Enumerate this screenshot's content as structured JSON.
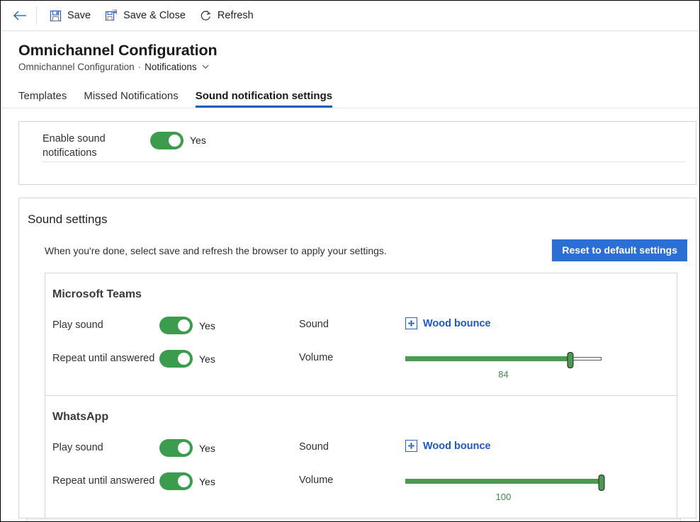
{
  "commandbar": {
    "back_label": "back-arrow",
    "buttons": [
      {
        "icon": "save-icon",
        "label": "Save"
      },
      {
        "icon": "save-and-close-icon",
        "label": "Save & Close"
      },
      {
        "icon": "refresh-icon",
        "label": "Refresh"
      }
    ]
  },
  "header": {
    "title": "Omnichannel Configuration",
    "breadcrumb": {
      "root": "Omnichannel Configuration",
      "separator": "·",
      "current": "Notifications",
      "chevron": "chevron-down-icon"
    }
  },
  "tabs": [
    {
      "label": "Templates",
      "active": false
    },
    {
      "label": "Missed Notifications",
      "active": false
    },
    {
      "label": "Sound notification settings",
      "active": true
    }
  ],
  "enable_panel": {
    "label": "Enable sound notifications",
    "toggle_value": "Yes"
  },
  "sound_settings": {
    "title": "Sound settings",
    "hint": "When you're done, select save and refresh the browser to apply your settings.",
    "reset_button": "Reset to default settings",
    "accent_blue": "#2b6fd4",
    "toggle_green": "#3b9c4e",
    "slider_green": "#4c9a52",
    "link_blue": "#1f57c3",
    "channels": [
      {
        "name": "Microsoft Teams",
        "play_sound_label": "Play sound",
        "play_sound_value": "Yes",
        "sound_label": "Sound",
        "sound_name": "Wood bounce",
        "sound_icon": "broken-image-icon",
        "repeat_label": "Repeat until answered",
        "repeat_value": "Yes",
        "volume_label": "Volume",
        "volume_value": "84"
      },
      {
        "name": "WhatsApp",
        "play_sound_label": "Play sound",
        "play_sound_value": "Yes",
        "sound_label": "Sound",
        "sound_name": "Wood bounce",
        "sound_icon": "broken-image-icon",
        "repeat_label": "Repeat until answered",
        "repeat_value": "Yes",
        "volume_label": "Volume",
        "volume_value": "100"
      }
    ]
  }
}
